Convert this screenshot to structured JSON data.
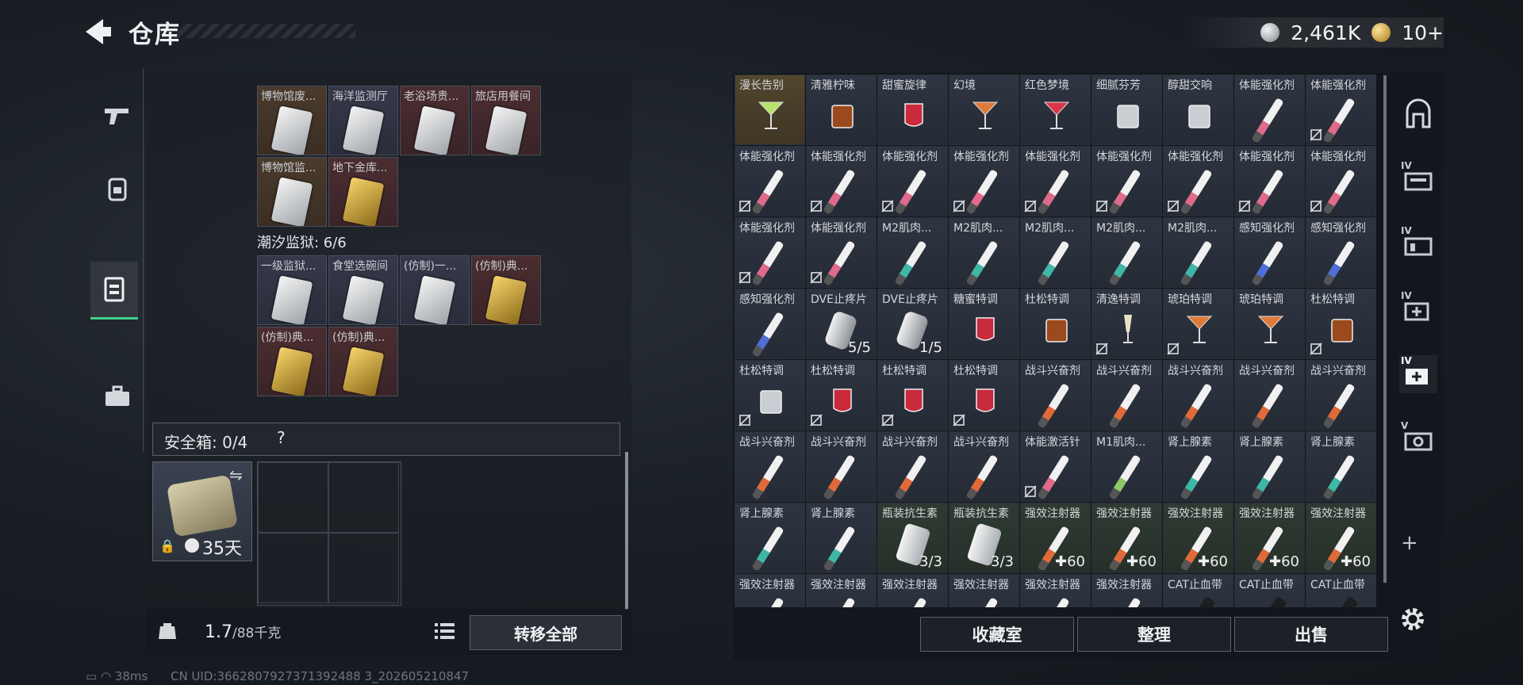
{
  "header": {
    "title": "仓库",
    "currencies": [
      {
        "icon": "silver-coin-icon",
        "value": "2,461K"
      },
      {
        "icon": "gold-coin-icon",
        "value": "10+"
      }
    ]
  },
  "left_rail": [
    "gun-icon",
    "backpack-icon",
    "vest-icon",
    "toolbox-icon"
  ],
  "collections": [
    {
      "title": "",
      "rows": [
        [
          {
            "label": "博物馆废...",
            "bg": "brown",
            "card": "white"
          },
          {
            "label": "海洋监测厅",
            "bg": "blue",
            "card": "white"
          },
          {
            "label": "老浴场贵...",
            "bg": "red",
            "card": "white"
          },
          {
            "label": "旅店用餐间",
            "bg": "red",
            "card": "white"
          }
        ],
        [
          {
            "label": "博物馆监...",
            "bg": "brown",
            "card": "white"
          },
          {
            "label": "地下金库...",
            "bg": "red",
            "card": "gold"
          }
        ]
      ]
    },
    {
      "title": "潮汐监狱: 6/6",
      "rows": [
        [
          {
            "label": "一级监狱...",
            "bg": "blue",
            "card": "white"
          },
          {
            "label": "食堂选碗间",
            "bg": "blue",
            "card": "white"
          },
          {
            "label": "(仿制)一...",
            "bg": "blue",
            "card": "white"
          },
          {
            "label": "(仿制)典...",
            "bg": "red",
            "card": "gold"
          }
        ],
        [
          {
            "label": "(仿制)典...",
            "bg": "red",
            "card": "gold"
          },
          {
            "label": "(仿制)典...",
            "bg": "red",
            "card": "gold"
          }
        ]
      ]
    }
  ],
  "safe_box": {
    "label": "安全箱: 0/4",
    "help": "?",
    "days": "35天"
  },
  "weight": {
    "current": "1.7",
    "max": "/88千克"
  },
  "buttons": {
    "transfer_all": "转移全部",
    "collection_room": "收藏室",
    "organize": "整理",
    "sell": "出售"
  },
  "status": {
    "ping": "38ms",
    "uid": "CN UID:3662807927371392488 3_202605210847"
  },
  "warehouse_items": [
    {
      "label": "漫长告别",
      "type": "cocktail-green",
      "bg": "hi"
    },
    {
      "label": "清雅柠味",
      "type": "tumbler-amber"
    },
    {
      "label": "甜蜜旋律",
      "type": "glass-red"
    },
    {
      "label": "幻境",
      "type": "cocktail-orange"
    },
    {
      "label": "红色梦境",
      "type": "cocktail-red"
    },
    {
      "label": "细腻芬芳",
      "type": "tumbler-clear"
    },
    {
      "label": "醇甜交响",
      "type": "tumbler-clear"
    },
    {
      "label": "体能强化剂",
      "type": "syringe-pink"
    },
    {
      "label": "体能强化剂",
      "type": "syringe-pink",
      "nt": true
    },
    {
      "label": "体能强化剂",
      "type": "syringe-pink",
      "nt": true
    },
    {
      "label": "体能强化剂",
      "type": "syringe-pink",
      "nt": true
    },
    {
      "label": "体能强化剂",
      "type": "syringe-pink",
      "nt": true
    },
    {
      "label": "体能强化剂",
      "type": "syringe-pink",
      "nt": true
    },
    {
      "label": "体能强化剂",
      "type": "syringe-pink",
      "nt": true
    },
    {
      "label": "体能强化剂",
      "type": "syringe-pink",
      "nt": true
    },
    {
      "label": "体能强化剂",
      "type": "syringe-pink",
      "nt": true
    },
    {
      "label": "体能强化剂",
      "type": "syringe-pink",
      "nt": true
    },
    {
      "label": "体能强化剂",
      "type": "syringe-pink",
      "nt": true
    },
    {
      "label": "体能强化剂",
      "type": "syringe-pink",
      "nt": true
    },
    {
      "label": "体能强化剂",
      "type": "syringe-pink",
      "nt": true
    },
    {
      "label": "M2肌肉...",
      "type": "syringe-teal"
    },
    {
      "label": "M2肌肉...",
      "type": "syringe-teal"
    },
    {
      "label": "M2肌肉...",
      "type": "syringe-teal"
    },
    {
      "label": "M2肌肉...",
      "type": "syringe-teal"
    },
    {
      "label": "M2肌肉...",
      "type": "syringe-teal"
    },
    {
      "label": "感知强化剂",
      "type": "syringe-blue"
    },
    {
      "label": "感知强化剂",
      "type": "syringe-blue"
    },
    {
      "label": "感知强化剂",
      "type": "syringe-blue"
    },
    {
      "label": "DVE止疼片",
      "type": "pills",
      "count": "5/5"
    },
    {
      "label": "DVE止疼片",
      "type": "pills",
      "count": "1/5"
    },
    {
      "label": "糖蜜特调",
      "type": "glass-red"
    },
    {
      "label": "杜松特调",
      "type": "tumbler-amber"
    },
    {
      "label": "清逸特调",
      "type": "flute",
      "nt": true
    },
    {
      "label": "琥珀特调",
      "type": "cocktail-orange",
      "nt": true
    },
    {
      "label": "琥珀特调",
      "type": "cocktail-orange"
    },
    {
      "label": "杜松特调",
      "type": "tumbler-amber",
      "nt": true
    },
    {
      "label": "杜松特调",
      "type": "tumbler-clear",
      "nt": true
    },
    {
      "label": "杜松特调",
      "type": "glass-red",
      "nt": true
    },
    {
      "label": "杜松特调",
      "type": "glass-red",
      "nt": true
    },
    {
      "label": "杜松特调",
      "type": "glass-red",
      "nt": true
    },
    {
      "label": "战斗兴奋剂",
      "type": "syringe-orange"
    },
    {
      "label": "战斗兴奋剂",
      "type": "syringe-orange"
    },
    {
      "label": "战斗兴奋剂",
      "type": "syringe-orange"
    },
    {
      "label": "战斗兴奋剂",
      "type": "syringe-orange"
    },
    {
      "label": "战斗兴奋剂",
      "type": "syringe-orange"
    },
    {
      "label": "战斗兴奋剂",
      "type": "syringe-orange"
    },
    {
      "label": "战斗兴奋剂",
      "type": "syringe-orange"
    },
    {
      "label": "战斗兴奋剂",
      "type": "syringe-orange"
    },
    {
      "label": "战斗兴奋剂",
      "type": "syringe-orange"
    },
    {
      "label": "体能激活针",
      "type": "syringe-pink",
      "nt": true
    },
    {
      "label": "M1肌肉...",
      "type": "syringe-green"
    },
    {
      "label": "肾上腺素",
      "type": "syringe-teal"
    },
    {
      "label": "肾上腺素",
      "type": "syringe-teal"
    },
    {
      "label": "肾上腺素",
      "type": "syringe-teal"
    },
    {
      "label": "肾上腺素",
      "type": "syringe-teal"
    },
    {
      "label": "肾上腺素",
      "type": "syringe-teal"
    },
    {
      "label": "瓶装抗生素",
      "type": "bottle",
      "count": "3/3",
      "bg": "green"
    },
    {
      "label": "瓶装抗生素",
      "type": "bottle",
      "count": "3/3",
      "bg": "green"
    },
    {
      "label": "强效注射器",
      "type": "syringe-orange",
      "count": "✚60",
      "bg": "green"
    },
    {
      "label": "强效注射器",
      "type": "syringe-orange",
      "count": "✚60",
      "bg": "green"
    },
    {
      "label": "强效注射器",
      "type": "syringe-orange",
      "count": "✚60",
      "bg": "green"
    },
    {
      "label": "强效注射器",
      "type": "syringe-orange",
      "count": "✚60",
      "bg": "green"
    },
    {
      "label": "强效注射器",
      "type": "syringe-orange",
      "count": "✚60",
      "bg": "green"
    },
    {
      "label": "强效注射器",
      "type": "syringe-orange"
    },
    {
      "label": "强效注射器",
      "type": "syringe-orange"
    },
    {
      "label": "强效注射器",
      "type": "syringe-orange"
    },
    {
      "label": "强效注射器",
      "type": "syringe-orange"
    },
    {
      "label": "强效注射器",
      "type": "syringe-orange"
    },
    {
      "label": "强效注射器",
      "type": "syringe-orange"
    },
    {
      "label": "CAT止血带",
      "type": "tourniquet"
    },
    {
      "label": "CAT止血带",
      "type": "tourniquet"
    },
    {
      "label": "CAT止血带",
      "type": "tourniquet"
    }
  ],
  "right_rail": [
    {
      "icon": "armor-icon",
      "roman": ""
    },
    {
      "icon": "storage-iv-icon",
      "roman": "IV"
    },
    {
      "icon": "storage-iv-icon",
      "roman": "IV"
    },
    {
      "icon": "storage-iv-plus-icon",
      "roman": "IV"
    },
    {
      "icon": "storage-iv-plus-active-icon",
      "roman": "IV"
    },
    {
      "icon": "storage-v-icon",
      "roman": "V"
    }
  ],
  "colors": {
    "accent_green": "#3fd18d",
    "highlight_gold": "#52462d"
  }
}
